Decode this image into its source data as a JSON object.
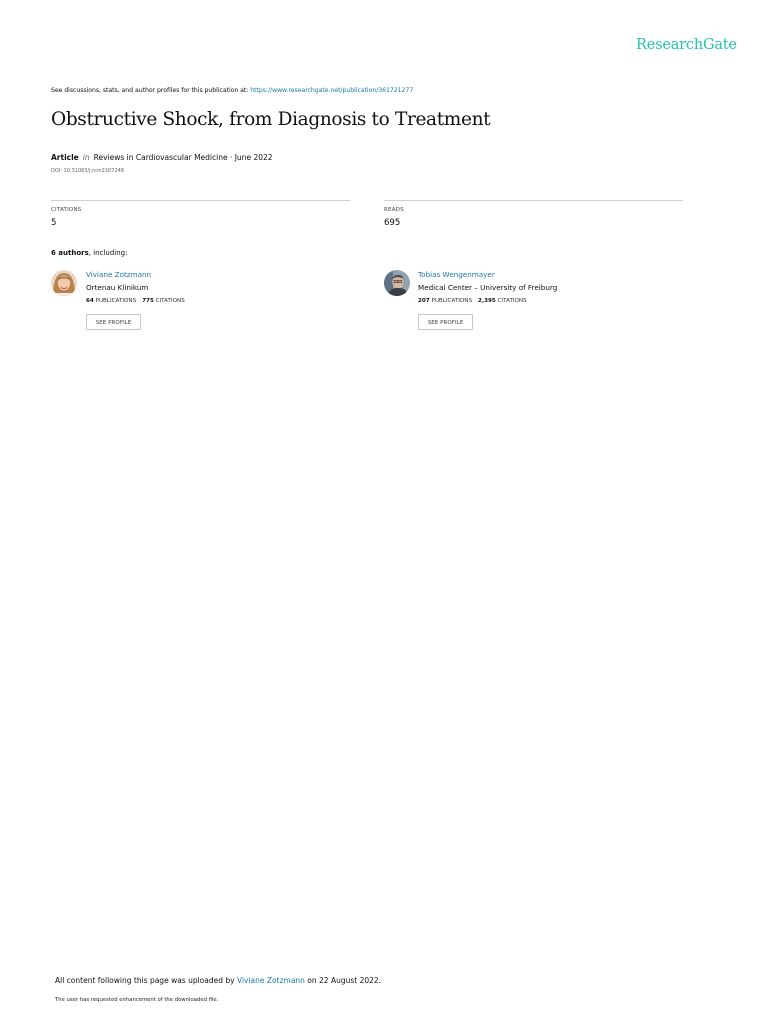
{
  "brand": {
    "name": "ResearchGate",
    "color": "#22c4b0"
  },
  "discussions": {
    "prefix": "See discussions, stats, and author profiles for this publication at: ",
    "url": "https://www.researchgate.net/publication/361721277"
  },
  "publication": {
    "title": "Obstructive Shock, from Diagnosis to Treatment",
    "type": "Article",
    "in_label": "in",
    "venue": "Reviews in Cardiovascular Medicine · June 2022",
    "doi": "DOI: 10.31083/j.rcm2307248"
  },
  "stats": {
    "citations_label": "CITATIONS",
    "citations_value": "5",
    "reads_label": "READS",
    "reads_value": "695"
  },
  "authors_heading": {
    "count": "6 authors",
    "suffix": ", including:"
  },
  "authors": [
    {
      "name": "Viviane Zotzmann",
      "institution": "Ortenau Klinikum",
      "publications_count": "64",
      "publications_label": "PUBLICATIONS",
      "citations_count": "775",
      "citations_label": "CITATIONS",
      "button_label": "SEE PROFILE"
    },
    {
      "name": "Tobias Wengenmayer",
      "institution": "Medical Center – University of Freiburg",
      "publications_count": "207",
      "publications_label": "PUBLICATIONS",
      "citations_count": "2,395",
      "citations_label": "CITATIONS",
      "button_label": "SEE PROFILE"
    }
  ],
  "footer": {
    "upload_prefix": "All content following this page was uploaded by ",
    "uploader": "Viviane Zotzmann",
    "upload_suffix": " on 22 August 2022.",
    "enhancement_note": "The user has requested enhancement of the downloaded file."
  },
  "colors": {
    "link": "#1a7aa8",
    "rule": "#cfcfcf"
  }
}
